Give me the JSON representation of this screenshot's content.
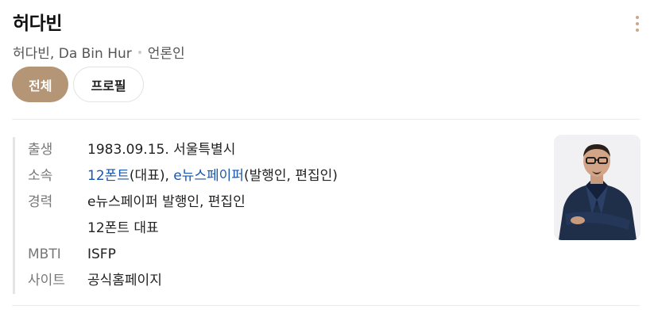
{
  "profile": {
    "name": "허다빈",
    "aliases": "허다빈, Da Bin Hur",
    "occupation": "언론인"
  },
  "tabs": [
    {
      "label": "전체",
      "active": true
    },
    {
      "label": "프로필",
      "active": false
    }
  ],
  "info": {
    "birth": {
      "label": "출생",
      "value": "1983.09.15. 서울특별시"
    },
    "affiliation": {
      "label": "소속",
      "org1": "12폰트",
      "role1": "(대표), ",
      "org2": "e뉴스페이퍼",
      "role2": "(발행인, 편집인)"
    },
    "career": {
      "label": "경력",
      "items": [
        "e뉴스페이퍼 발행인, 편집인",
        "12폰트 대표"
      ]
    },
    "mbti": {
      "label": "MBTI",
      "value": "ISFP"
    },
    "site": {
      "label": "사이트",
      "value": "공식홈페이지"
    }
  },
  "colors": {
    "accent": "#b49576",
    "link": "#1a56b0"
  },
  "icons": {
    "more": "more-vertical-icon",
    "photo": "profile-photo"
  }
}
